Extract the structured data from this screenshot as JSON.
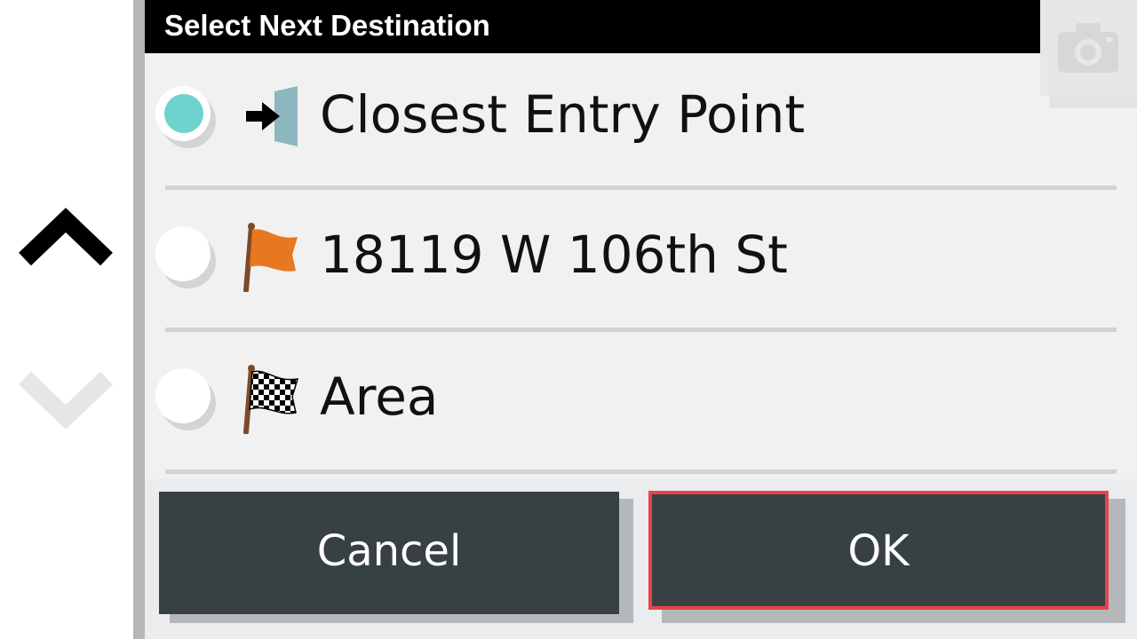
{
  "dialog": {
    "title": "Select Next Destination",
    "options": [
      {
        "label": "Closest Entry Point",
        "icon": "entry-point-icon",
        "selected": true
      },
      {
        "label": "18119 W 106th St",
        "icon": "orange-flag-icon",
        "selected": false
      },
      {
        "label": "Area",
        "icon": "checkered-flag-icon",
        "selected": false
      }
    ],
    "cancel_label": "Cancel",
    "ok_label": "OK"
  },
  "nav": {
    "scroll_up_icon": "chevron-up-icon",
    "scroll_down_icon": "chevron-down-icon"
  },
  "colors": {
    "accent_selected": "#6dd3cd",
    "button_bg": "#374043",
    "highlight_border": "#e8434b",
    "flag_orange": "#e87722"
  }
}
